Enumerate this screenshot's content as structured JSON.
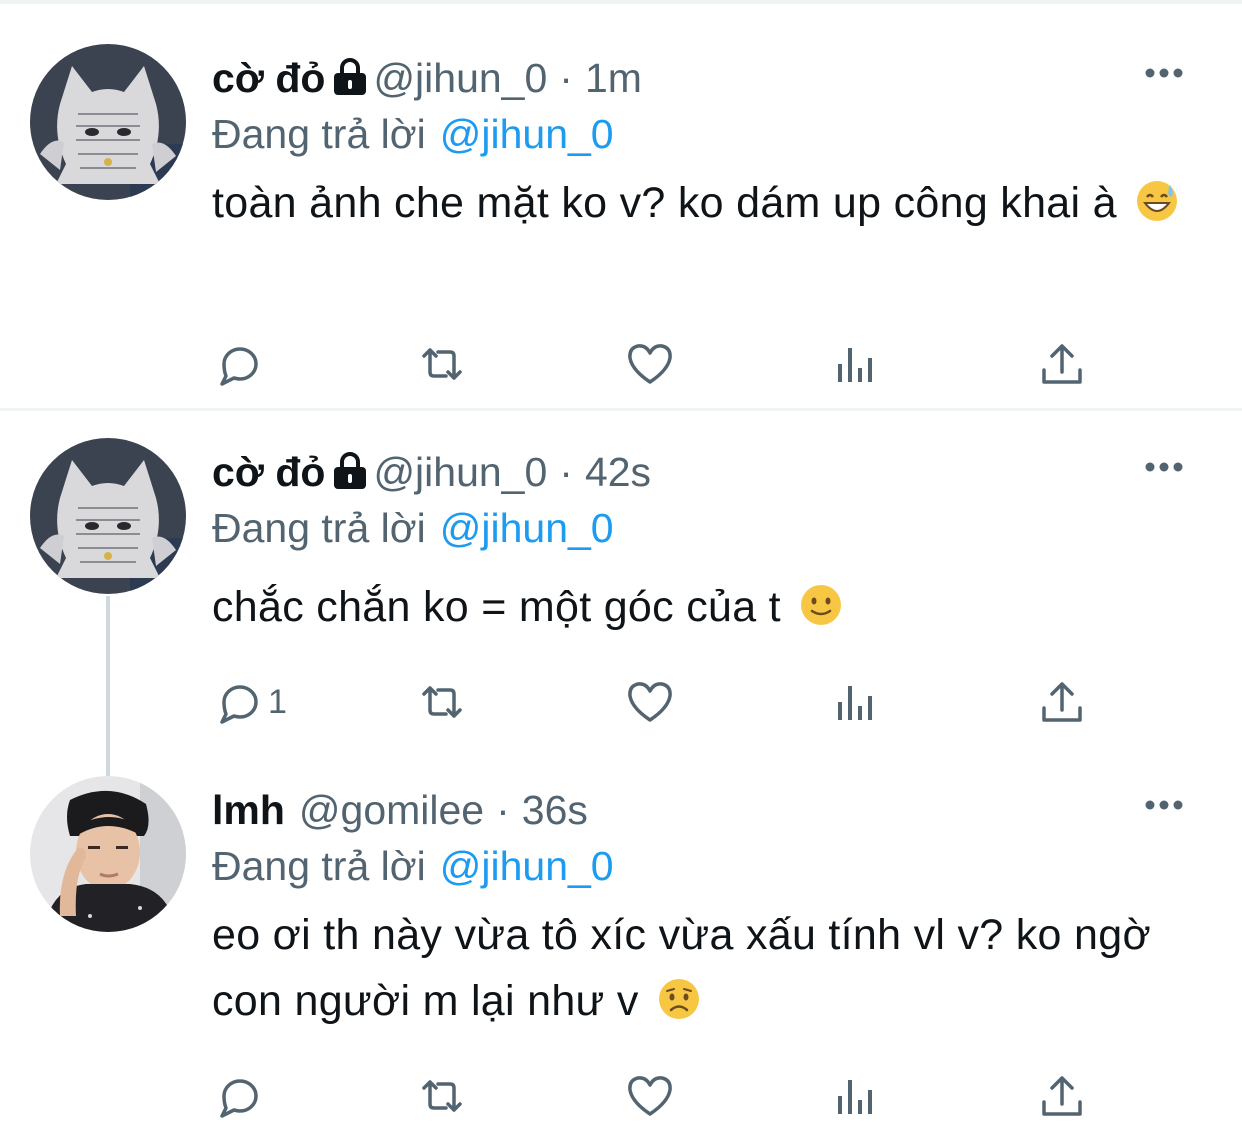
{
  "tweets": [
    {
      "display_name": "cờ đỏ",
      "handle": "@jihun_0",
      "separator": "·",
      "time": "1m",
      "reply_prefix": "Đang trả lời",
      "reply_to": "@jihun_0",
      "text": "toàn ảnh che mặt ko v? ko dám up công khai à",
      "emoji": "grinning-sweat-emoji",
      "reply_count": "",
      "locked": true
    },
    {
      "display_name": "cờ đỏ",
      "handle": "@jihun_0",
      "separator": "·",
      "time": "42s",
      "reply_prefix": "Đang trả lời",
      "reply_to": "@jihun_0",
      "text": "chắc chắn ko = một góc của t",
      "emoji": "slightly-smiling-emoji",
      "reply_count": "1",
      "locked": true
    },
    {
      "display_name": "lmh",
      "handle": "@gomilee",
      "separator": "·",
      "time": "36s",
      "reply_prefix": "Đang trả lời",
      "reply_to": "@jihun_0",
      "text": "eo ơi th này vừa tô xíc vừa xấu tính vl v? ko ngờ con người m lại như v",
      "emoji": "worried-face-emoji",
      "reply_count": "",
      "locked": false
    }
  ],
  "colors": {
    "link": "#1d9bf0",
    "secondary_text": "#536471",
    "primary_text": "#0f1419",
    "divider": "#eff3f4",
    "thread_line": "#cfd9de"
  },
  "icons": [
    "lock-icon",
    "more-icon",
    "reply-icon",
    "retweet-icon",
    "like-icon",
    "views-icon",
    "share-icon"
  ]
}
